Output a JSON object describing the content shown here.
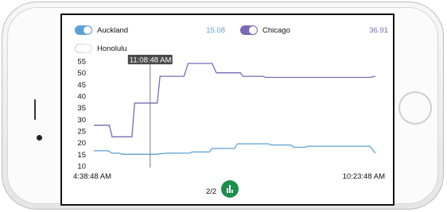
{
  "legend": [
    {
      "name": "Auckland",
      "value": "15.08",
      "enabled": true,
      "color": "#5aa1d9"
    },
    {
      "name": "Chicago",
      "value": "36.91",
      "enabled": true,
      "color": "#7a68b8"
    },
    {
      "name": "Honolulu",
      "enabled": false
    }
  ],
  "cursor": {
    "time_label": "11:08:48 AM"
  },
  "x_axis": {
    "start_label": "4:38:48 AM",
    "end_label": "10:23:48 AM"
  },
  "pagination": {
    "label": "2/2"
  },
  "icons": {
    "chart": "bar-chart-icon"
  },
  "chart_data": {
    "type": "line",
    "ylim": [
      10,
      55
    ],
    "y_ticks": [
      "10",
      "15",
      "20",
      "25",
      "30",
      "35",
      "40",
      "45",
      "50",
      "55"
    ],
    "x_range_labels": [
      "4:38:48 AM",
      "10:23:48 AM"
    ],
    "grid": false,
    "series": [
      {
        "name": "Auckland",
        "color": "#5aa1d9",
        "points": [
          [
            0,
            16.5
          ],
          [
            0.05,
            16.5
          ],
          [
            0.065,
            15.5
          ],
          [
            0.09,
            15.5
          ],
          [
            0.1,
            15
          ],
          [
            0.22,
            15
          ],
          [
            0.26,
            15.5
          ],
          [
            0.34,
            15.5
          ],
          [
            0.35,
            16
          ],
          [
            0.41,
            16
          ],
          [
            0.42,
            17.5
          ],
          [
            0.5,
            17.5
          ],
          [
            0.51,
            19.5
          ],
          [
            0.61,
            19.5
          ],
          [
            0.62,
            19.5
          ],
          [
            0.63,
            19
          ],
          [
            0.7,
            19
          ],
          [
            0.71,
            18
          ],
          [
            0.75,
            18
          ],
          [
            0.76,
            18.5
          ],
          [
            0.98,
            18.5
          ],
          [
            1.0,
            15.5
          ]
        ]
      },
      {
        "name": "Chicago",
        "color": "#7a68b8",
        "points": [
          [
            0,
            27.5
          ],
          [
            0.055,
            27.5
          ],
          [
            0.065,
            22.5
          ],
          [
            0.135,
            22.5
          ],
          [
            0.145,
            37
          ],
          [
            0.225,
            37
          ],
          [
            0.235,
            48.5
          ],
          [
            0.32,
            48.5
          ],
          [
            0.335,
            54
          ],
          [
            0.42,
            54
          ],
          [
            0.435,
            50
          ],
          [
            0.52,
            50
          ],
          [
            0.53,
            48.5
          ],
          [
            0.6,
            48.5
          ],
          [
            0.61,
            48
          ],
          [
            0.98,
            48
          ],
          [
            1.0,
            48.5
          ]
        ]
      }
    ],
    "cursor_x": 0.2
  }
}
